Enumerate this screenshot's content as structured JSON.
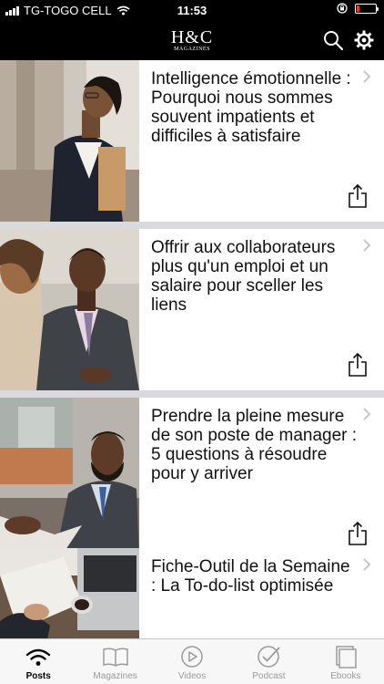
{
  "status_bar": {
    "carrier": "TG-TOGO CELL",
    "time": "11:53",
    "battery_level": 0.15,
    "battery_color": "#ff3b30"
  },
  "header": {
    "logo_main": "H&C",
    "logo_sub": "MAGAZINES",
    "icons": [
      "search-icon",
      "gear-icon"
    ]
  },
  "articles": [
    {
      "title": "Intelligence émotionnelle : Pourquoi nous sommes souvent impatients et difficiles à satisfaire"
    },
    {
      "title": "Offrir aux collaborateurs plus qu'un emploi et un salaire pour sceller les liens"
    },
    {
      "title": "Prendre la pleine mesure de son poste de manager : 5 questions à résoudre pour y arriver"
    },
    {
      "title": "Fiche-Outil de la Semaine : La To-do-list optimisée"
    }
  ],
  "tabs": [
    {
      "label": "Posts",
      "icon": "wifi-icon",
      "active": true
    },
    {
      "label": "Magazines",
      "icon": "book-icon",
      "active": false
    },
    {
      "label": "Videos",
      "icon": "play-icon",
      "active": false
    },
    {
      "label": "Podcast",
      "icon": "check-icon",
      "active": false
    },
    {
      "label": "Ebooks",
      "icon": "pages-icon",
      "active": false
    }
  ]
}
